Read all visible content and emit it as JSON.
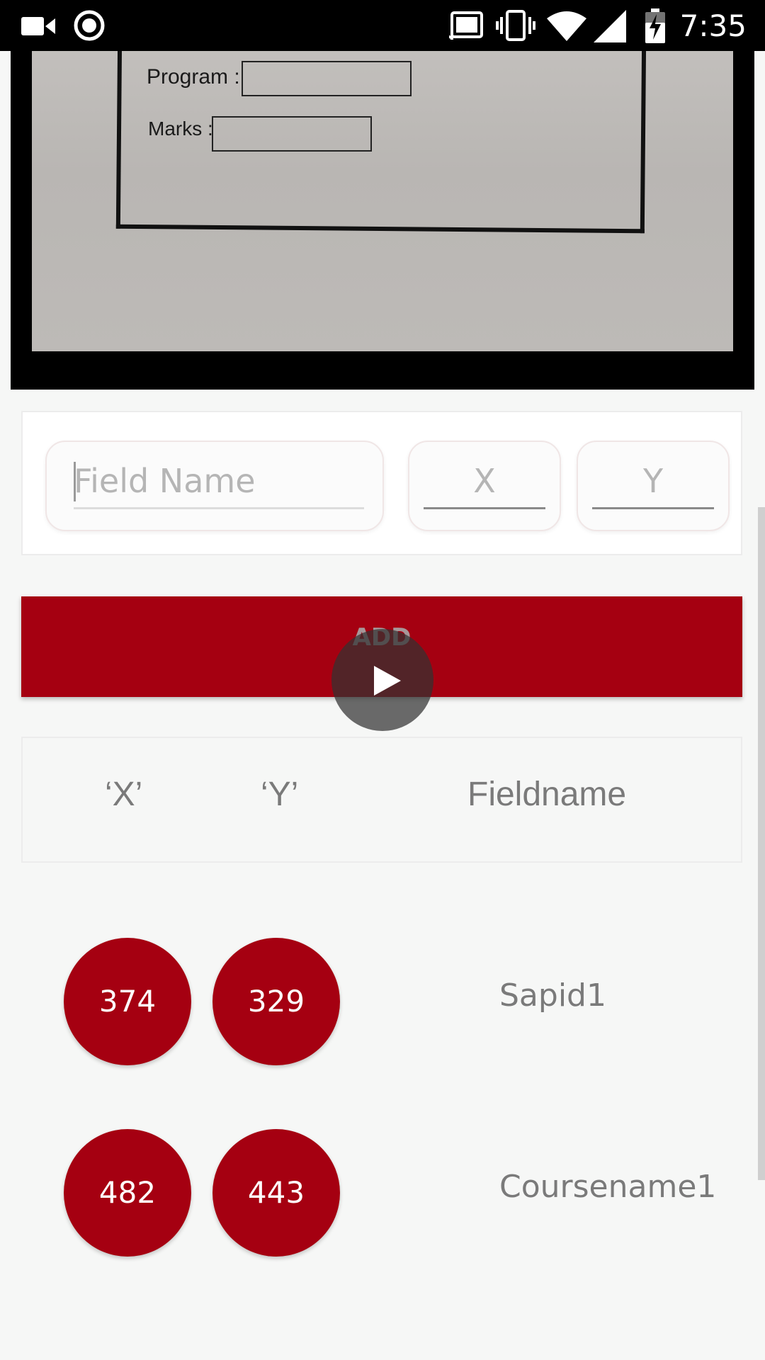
{
  "status_bar": {
    "time": "7:35",
    "icons": [
      "video-camera-icon",
      "record-icon",
      "cast-icon",
      "vibrate-icon",
      "wifi-icon",
      "signal-icon",
      "battery-charging-icon"
    ]
  },
  "document_preview": {
    "labels": [
      "Program :",
      "Marks :"
    ]
  },
  "entry": {
    "field_name_placeholder": "Field Name",
    "x_placeholder": "X",
    "y_placeholder": "Y"
  },
  "add_button": {
    "label": "ADD"
  },
  "table": {
    "headers": [
      "‘X’",
      "‘Y’",
      "Fieldname"
    ],
    "rows": [
      {
        "x": "374",
        "y": "329",
        "fieldname": "Sapid1"
      },
      {
        "x": "482",
        "y": "443",
        "fieldname": "Coursename1"
      }
    ]
  },
  "colors": {
    "accent": "#a50011",
    "status_bar": "#000000",
    "background": "#f6f7f6"
  }
}
